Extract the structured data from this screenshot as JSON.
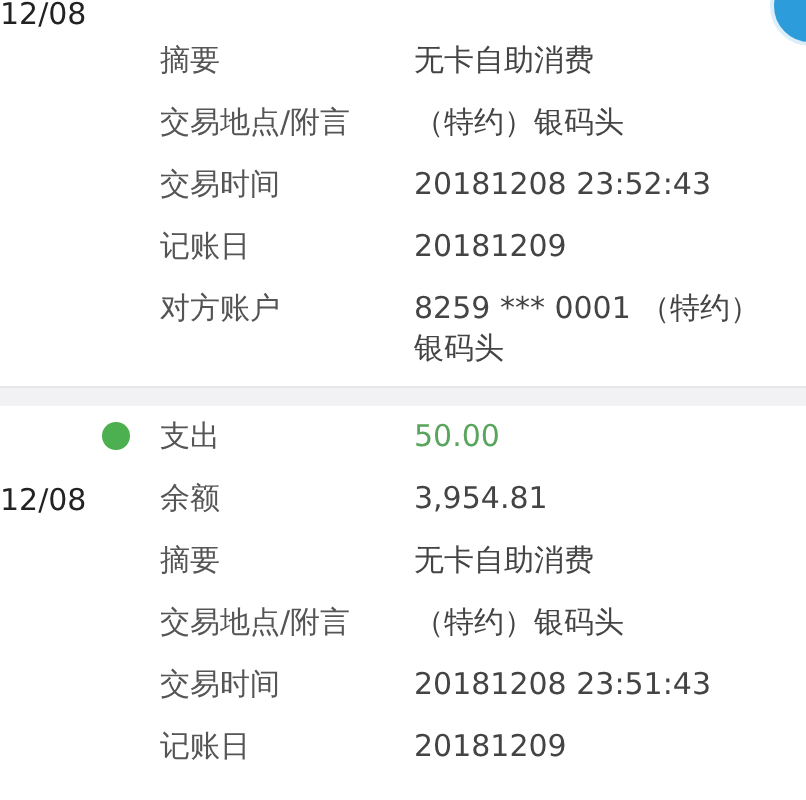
{
  "transactions": [
    {
      "date": "12/08",
      "rows": [
        {
          "kind": "field",
          "label": "摘要",
          "value": "无卡自助消费"
        },
        {
          "kind": "field",
          "label": "交易地点/附言",
          "value": "（特约）银码头"
        },
        {
          "kind": "field",
          "label": "交易时间",
          "value": "20181208 23:52:43"
        },
        {
          "kind": "field",
          "label": "记账日",
          "value": "20181209"
        },
        {
          "kind": "field",
          "label": "对方账户",
          "value": "8259 *** 0001 （特约）银码头"
        }
      ]
    },
    {
      "date": "12/08",
      "color": "#4caf50",
      "rows": [
        {
          "kind": "amount",
          "label": "支出",
          "value": "50.00"
        },
        {
          "kind": "field",
          "label": "余额",
          "value": "3,954.81"
        },
        {
          "kind": "field",
          "label": "摘要",
          "value": "无卡自助消费"
        },
        {
          "kind": "field",
          "label": "交易地点/附言",
          "value": "（特约）银码头"
        },
        {
          "kind": "field",
          "label": "交易时间",
          "value": "20181208 23:51:43"
        },
        {
          "kind": "field",
          "label": "记账日",
          "value": "20181209"
        }
      ]
    }
  ]
}
